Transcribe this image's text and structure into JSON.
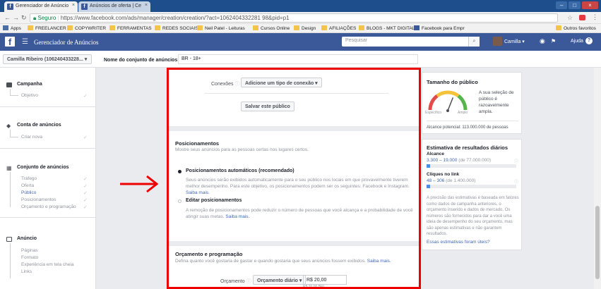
{
  "browser": {
    "tabs": [
      {
        "label": "Gerenciador de Anúncio"
      },
      {
        "label": "Anúncios de oferta | Ce"
      }
    ],
    "address": {
      "secure_label": "Seguro",
      "url": "https://www.facebook.com/ads/manager/creation/creation/?act=1062404332281 98&pid=p1"
    },
    "bookmarks": [
      {
        "label": "Apps",
        "kind": "apps"
      },
      {
        "label": "FREELANCER",
        "kind": "folder"
      },
      {
        "label": "COPYWRITER",
        "kind": "folder"
      },
      {
        "label": "FERRAMENTAS",
        "kind": "folder"
      },
      {
        "label": "REDES SOCIAIS",
        "kind": "folder"
      },
      {
        "label": "Neil Patel - Leituras",
        "kind": "folder"
      },
      {
        "label": "Cursos Online",
        "kind": "folder"
      },
      {
        "label": "Design",
        "kind": "folder"
      },
      {
        "label": "AFILIAÇÕES",
        "kind": "folder"
      },
      {
        "label": "BLOGS - MKT DIGITAL",
        "kind": "folder"
      },
      {
        "label": "Facebook para Empr",
        "kind": "fb"
      },
      {
        "label": "Outros favoritos",
        "kind": "folder"
      }
    ]
  },
  "fb": {
    "title": "Gerenciador de Anúncios",
    "search_placeholder": "Pesquisar",
    "user_name": "Camilla",
    "help_label": "Ajuda"
  },
  "subbar": {
    "account": "Camilla Ribeiro (106240433228...",
    "setname_label": "Nome do conjunto de anúncios",
    "setname_value": "BR - 18+"
  },
  "sidebar": {
    "sections": [
      {
        "title": "Campanha",
        "items": [
          {
            "label": "Objetivo",
            "active": false,
            "done": true
          }
        ]
      },
      {
        "title": "Conta de anúncios",
        "items": [
          {
            "label": "Criar nova",
            "active": false,
            "done": true
          }
        ]
      },
      {
        "title": "Conjunto de anúncios",
        "items": [
          {
            "label": "Tráfego",
            "active": false,
            "done": true
          },
          {
            "label": "Oferta",
            "active": false,
            "done": true
          },
          {
            "label": "Público",
            "active": true,
            "done": true
          },
          {
            "label": "Posicionamentos",
            "active": false,
            "done": true
          },
          {
            "label": "Orçamento e programação",
            "active": false,
            "done": true
          }
        ]
      },
      {
        "title": "Anúncio",
        "items": [
          {
            "label": "Páginas",
            "active": false,
            "done": false
          },
          {
            "label": "Formato",
            "active": false,
            "done": false
          },
          {
            "label": "Experiência em tela cheia",
            "active": false,
            "done": false
          },
          {
            "label": "Links",
            "active": false,
            "done": false
          }
        ]
      }
    ]
  },
  "main": {
    "connections_label": "Conexões",
    "connections_button": "Adicione um tipo de conexão ▾",
    "save_audience": "Salvar este público",
    "placements": {
      "title": "Posicionamentos",
      "subtitle": "Mostre seus anúncios para as pessoas certas nos lugares certos.",
      "auto_label": "Posicionamentos automáticos (recomendado)",
      "auto_desc": "Seus anúncios serão exibidos automaticamente para o seu público nos locais em que provavelmente tiverem melhor desempenho. Para este objetivo, os posicionamentos podem ser os seguintes: Facebook e Instagram.",
      "auto_link": "Saiba mais.",
      "edit_label": "Editar posicionamentos",
      "edit_desc": "A remoção de posicionamentos pode reduzir o número de pessoas que você alcança e a probabilidade de você atingir suas metas.",
      "edit_link": "Saiba mais."
    },
    "budget": {
      "title": "Orçamento e programação",
      "subtitle": "Defina quanto você gostaria de gastar e quando gostaria que seus anúncios fossem exibidos.",
      "subtitle_link": "Saiba mais.",
      "budget_label": "Orçamento",
      "budget_type": "Orçamento diário ▾",
      "budget_value": "R$ 20,00",
      "budget_note": "R$ 20,00 BRL"
    }
  },
  "audience": {
    "title": "Tamanho do público",
    "gauge_level": 0.62,
    "gauge_left": "Específico",
    "gauge_right": "Amplo",
    "text": "A sua seleção de público é razoavelmente ampla.",
    "potential": "Alcance potencial: 113.000.000 de pessoas"
  },
  "estimates": {
    "title": "Estimativa de resultados diários",
    "reach_label": "Alcance",
    "reach_value": "3.300 – 19.000",
    "reach_total": "(de 77.000.000)",
    "reach_fill": 0.04,
    "clicks_label": "Cliques no link",
    "clicks_value": "48 – 306",
    "clicks_total": "(de 1.400.000)",
    "clicks_fill": 0.04,
    "note": "A precisão das estimativas é baseada em fatores como dados de campanha anteriores, o orçamento inserido e dados de mercado. Os números são fornecidos para dar a você uma ideia de desempenho do seu orçamento, mas são apenas estimativas e não garantem resultados.",
    "feedback_link": "Essas estimativas foram úteis?"
  },
  "colors": {
    "fb_blue": "#3b5998",
    "highlight_red": "#e00000",
    "link": "#4267b2"
  }
}
